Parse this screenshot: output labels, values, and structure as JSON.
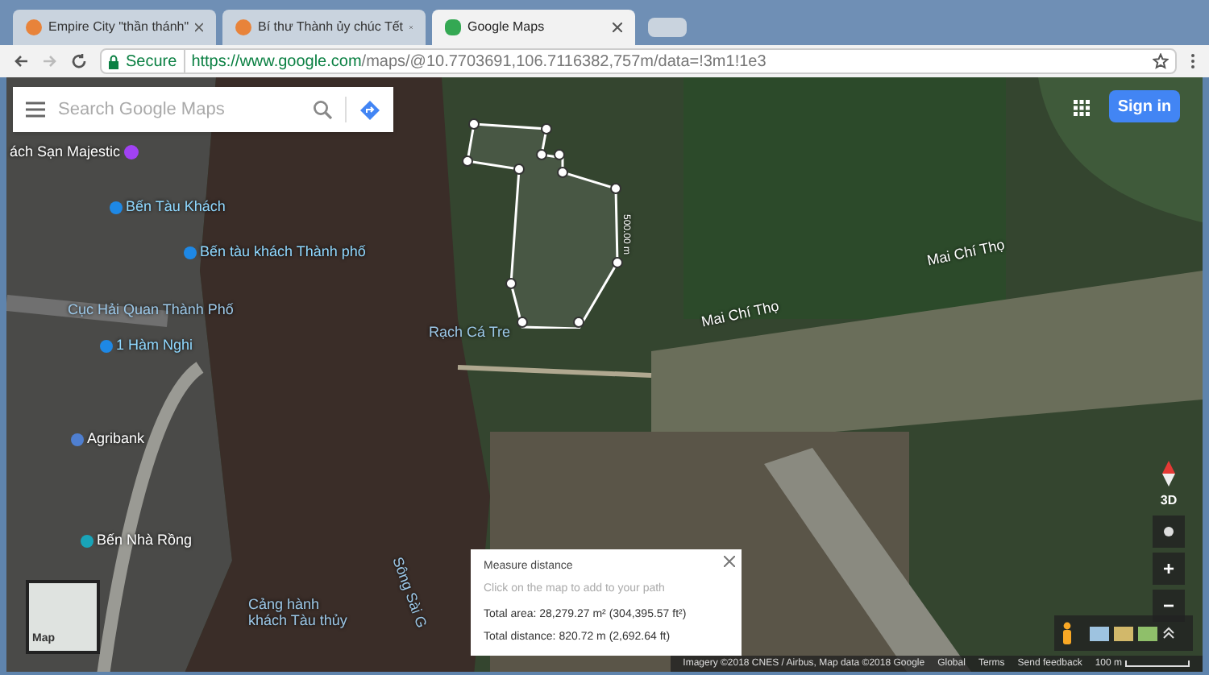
{
  "tabs": [
    {
      "title": "Empire City \"thần thánh\"",
      "selected": false
    },
    {
      "title": "Bí thư Thành ủy chúc Tết",
      "selected": false
    },
    {
      "title": "Google Maps",
      "selected": true
    }
  ],
  "address_bar": {
    "secure_label": "Secure",
    "url_host": "https://www.google.com",
    "url_path": "/maps/@10.7703691,106.7116382,757m/data=!3m1!1e3"
  },
  "search": {
    "placeholder": "Search Google Maps"
  },
  "sign_in": "Sign in",
  "map_labels": [
    {
      "text": "ách Sạn Majestic",
      "kind": "place"
    },
    {
      "text": "Bến Tàu Khách",
      "kind": "transit"
    },
    {
      "text": "Bến tàu khách Thành phố",
      "kind": "transit"
    },
    {
      "text": "Cục Hải Quan Thành Phố",
      "kind": "area"
    },
    {
      "text": "1 Hàm Nghi",
      "kind": "transit"
    },
    {
      "text": "Agribank",
      "kind": "bank"
    },
    {
      "text": "Bến Nhà Rồng",
      "kind": "museum"
    },
    {
      "text": "Rạch Cá Tre",
      "kind": "area"
    },
    {
      "text": "Mai Chí Thọ",
      "kind": "road"
    },
    {
      "text": "Mai Chí Thọ",
      "kind": "road"
    },
    {
      "text": "Cảng hành khách Tàu thủy",
      "kind": "area"
    },
    {
      "text": "Sông Sài G",
      "kind": "water"
    },
    {
      "text": "500.00 m",
      "kind": "measure"
    }
  ],
  "measure_card": {
    "title": "Measure distance",
    "hint": "Click on the map to add to your path",
    "area": "Total area: 28,279.27 m² (304,395.57 ft²)",
    "distance": "Total distance: 820.72 m (2,692.64 ft)"
  },
  "controls": {
    "tilt": "3D",
    "zoom_in": "+",
    "zoom_out": "−"
  },
  "minimap_label": "Map",
  "footer": [
    "Imagery ©2018 CNES / Airbus, Map data ©2018 Google",
    "Global",
    "Terms",
    "Send feedback",
    "100 m"
  ]
}
